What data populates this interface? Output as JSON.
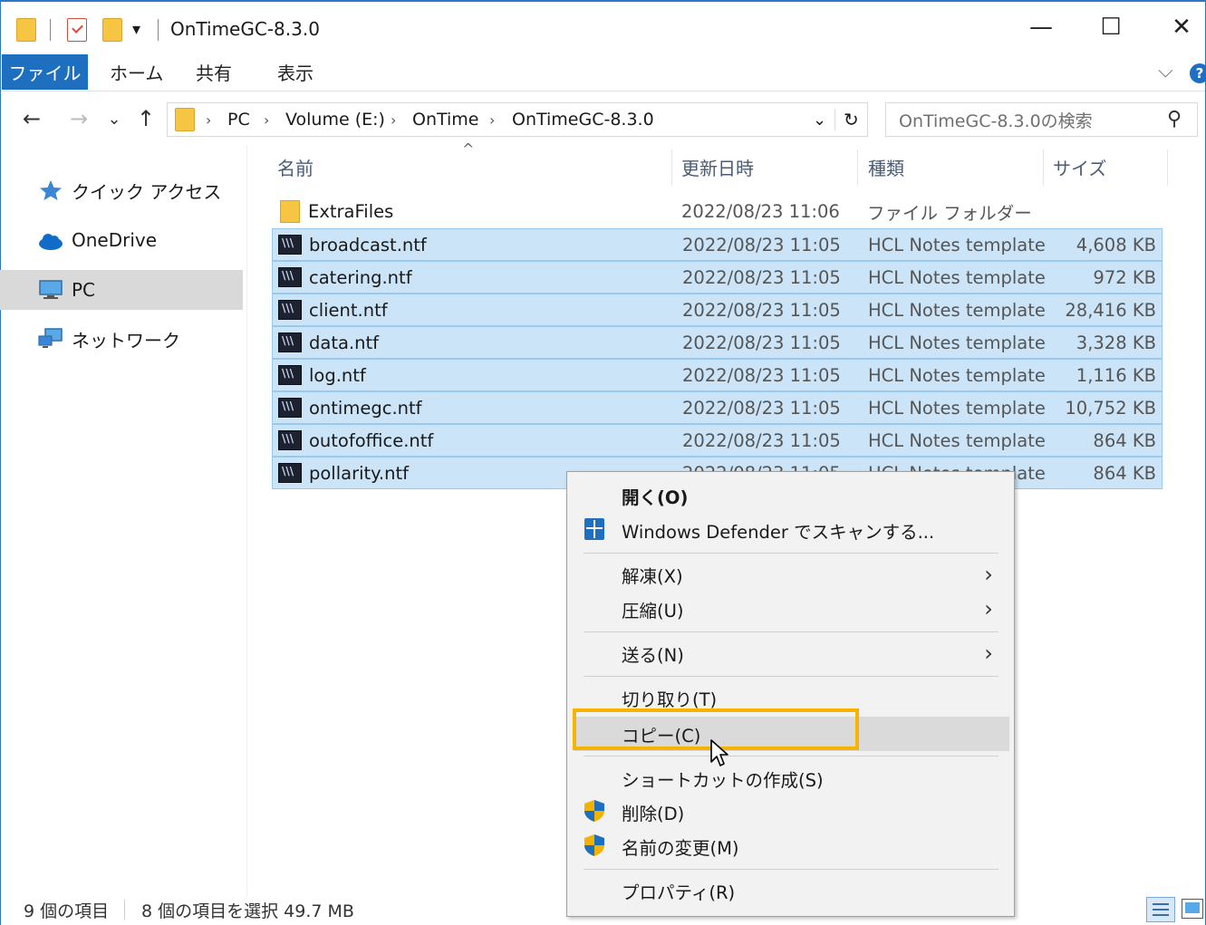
{
  "window": {
    "title": "OnTimeGC-8.3.0",
    "qat_dropdown": "▾",
    "minimize": "—",
    "maximize": "☐",
    "close": "✕"
  },
  "ribbon": {
    "tabs": [
      "ファイル",
      "ホーム",
      "共有",
      "表示"
    ],
    "collapse": "⌵",
    "help": "?"
  },
  "address": {
    "back": "←",
    "forward": "→",
    "recent": "⌄",
    "up": "↑",
    "crumbs": [
      "PC",
      "Volume (E:)",
      "OnTime",
      "OnTimeGC-8.3.0"
    ],
    "separator": "›",
    "dropdown": "⌄",
    "refresh": "↻",
    "search_placeholder": "OnTimeGC-8.3.0の検索",
    "search_icon": "⚲"
  },
  "nav": [
    {
      "label": "クイック アクセス",
      "icon": "star-icon"
    },
    {
      "label": "OneDrive",
      "icon": "cloud-icon"
    },
    {
      "label": "PC",
      "icon": "monitor-icon",
      "selected": true
    },
    {
      "label": "ネットワーク",
      "icon": "network-icon"
    }
  ],
  "columns": {
    "name": "名前",
    "date": "更新日時",
    "type": "種類",
    "size": "サイズ",
    "sort_indicator": "^"
  },
  "files": [
    {
      "name": "ExtraFiles",
      "date": "2022/08/23 11:06",
      "type": "ファイル フォルダー",
      "size": "",
      "selected": false,
      "icon": "folder-icon"
    },
    {
      "name": "broadcast.ntf",
      "date": "2022/08/23 11:05",
      "type": "HCL Notes template",
      "size": "4,608 KB",
      "selected": true,
      "icon": "notes-template-icon"
    },
    {
      "name": "catering.ntf",
      "date": "2022/08/23 11:05",
      "type": "HCL Notes template",
      "size": "972 KB",
      "selected": true,
      "icon": "notes-template-icon"
    },
    {
      "name": "client.ntf",
      "date": "2022/08/23 11:05",
      "type": "HCL Notes template",
      "size": "28,416 KB",
      "selected": true,
      "icon": "notes-template-icon"
    },
    {
      "name": "data.ntf",
      "date": "2022/08/23 11:05",
      "type": "HCL Notes template",
      "size": "3,328 KB",
      "selected": true,
      "icon": "notes-template-icon"
    },
    {
      "name": "log.ntf",
      "date": "2022/08/23 11:05",
      "type": "HCL Notes template",
      "size": "1,116 KB",
      "selected": true,
      "icon": "notes-template-icon"
    },
    {
      "name": "ontimegc.ntf",
      "date": "2022/08/23 11:05",
      "type": "HCL Notes template",
      "size": "10,752 KB",
      "selected": true,
      "icon": "notes-template-icon"
    },
    {
      "name": "outofoffice.ntf",
      "date": "2022/08/23 11:05",
      "type": "HCL Notes template",
      "size": "864 KB",
      "selected": true,
      "icon": "notes-template-icon"
    },
    {
      "name": "pollarity.ntf",
      "date": "2022/08/23 11:05",
      "type": "HCL Notes template",
      "size": "864 KB",
      "selected": true,
      "icon": "notes-template-icon"
    }
  ],
  "status": {
    "item_count": "9 個の項目",
    "selection": "8 個の項目を選択  49.7 MB",
    "view_details": "details-view-icon",
    "view_large": "large-icons-view-icon"
  },
  "context_menu": {
    "open": "開く(O)",
    "defender": "Windows Defender でスキャンする...",
    "extract": "解凍(X)",
    "compress": "圧縮(U)",
    "send_to": "送る(N)",
    "cut": "切り取り(T)",
    "copy": "コピー(C)",
    "shortcut": "ショートカットの作成(S)",
    "delete": "削除(D)",
    "rename": "名前の変更(M)",
    "properties": "プロパティ(R)",
    "submenu_arrow": "›"
  },
  "colors": {
    "accent": "#1f6fc1",
    "selection_fill": "#cce4f7",
    "selection_border": "#99c9ef",
    "highlight_box": "#f5b400"
  }
}
